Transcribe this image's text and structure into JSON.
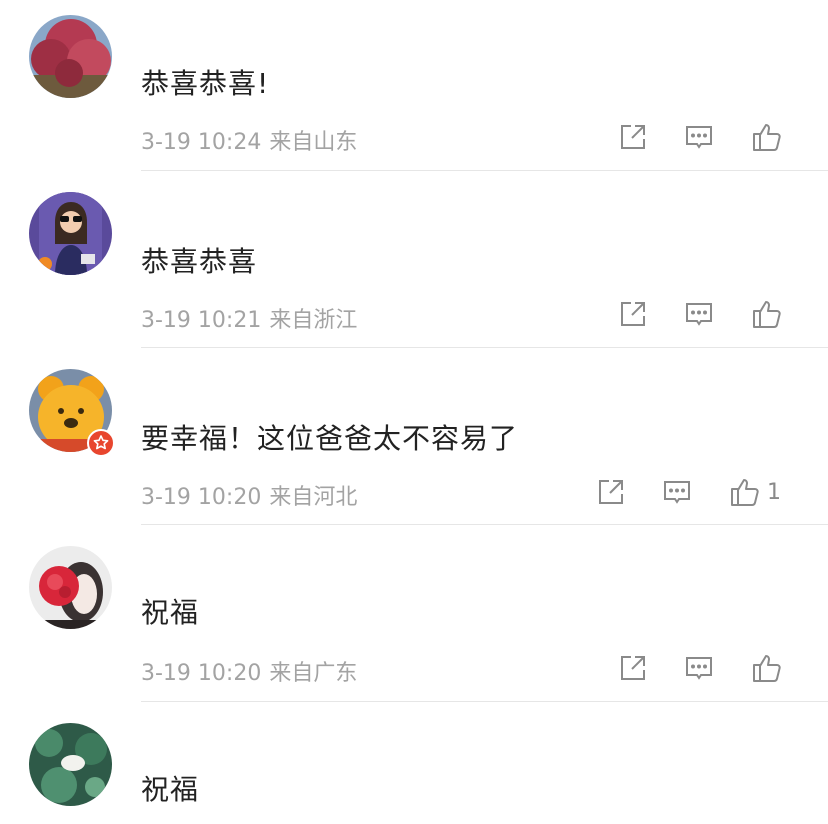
{
  "comments": [
    {
      "text": "恭喜恭喜!",
      "time": "3-19 10:24",
      "location": "来自山东",
      "likes": ""
    },
    {
      "text": "恭喜恭喜",
      "time": "3-19 10:21",
      "location": "来自浙江",
      "likes": ""
    },
    {
      "text": "要幸福！这位爸爸太不容易了",
      "time": "3-19 10:20",
      "location": "来自河北",
      "likes": "1"
    },
    {
      "text": "祝福",
      "time": "3-19 10:20",
      "location": "来自广东",
      "likes": ""
    },
    {
      "text": "祝福",
      "time": "",
      "location": "",
      "likes": ""
    }
  ],
  "icons": {
    "share": "share-icon",
    "reply": "reply-icon",
    "like": "thumbs-up-icon",
    "verified_badge": "star-badge-icon"
  },
  "colors": {
    "text": "#222222",
    "meta": "#a3a3a3",
    "icon": "#8a8a8a",
    "divider": "#e6e6e6",
    "badge": "#e8462e"
  }
}
